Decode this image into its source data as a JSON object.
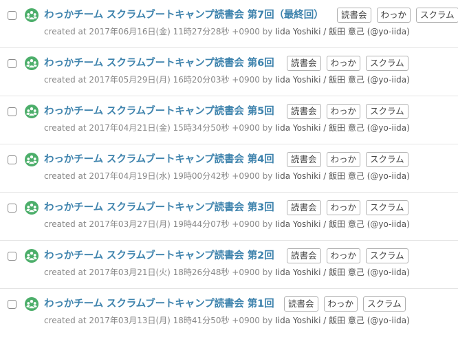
{
  "posts": [
    {
      "title": "わっかチーム スクラムブートキャンプ読書会 第7回（最終回）",
      "meta_prefix": "created at 2017年06月16日(金) 11時27分28秒 +0900 by",
      "author": "Iida Yoshiki / 飯田 意己 (@yo-iida)",
      "tags": [
        "読書会",
        "わっか",
        "スクラム"
      ]
    },
    {
      "title": "わっかチーム スクラムブートキャンプ読書会 第6回",
      "meta_prefix": "created at 2017年05月29日(月) 16時20分03秒 +0900 by",
      "author": "Iida Yoshiki / 飯田 意己 (@yo-iida)",
      "tags": [
        "読書会",
        "わっか",
        "スクラム"
      ]
    },
    {
      "title": "わっかチーム スクラムブートキャンプ読書会 第5回",
      "meta_prefix": "created at 2017年04月21日(金) 15時34分50秒 +0900 by",
      "author": "Iida Yoshiki / 飯田 意己 (@yo-iida)",
      "tags": [
        "読書会",
        "わっか",
        "スクラム"
      ]
    },
    {
      "title": "わっかチーム スクラムブートキャンプ読書会 第4回",
      "meta_prefix": "created at 2017年04月19日(水) 19時00分42秒 +0900 by",
      "author": "Iida Yoshiki / 飯田 意己 (@yo-iida)",
      "tags": [
        "読書会",
        "わっか",
        "スクラム"
      ]
    },
    {
      "title": "わっかチーム スクラムブートキャンプ読書会 第3回",
      "meta_prefix": "created at 2017年03月27日(月) 19時44分07秒 +0900 by",
      "author": "Iida Yoshiki / 飯田 意己 (@yo-iida)",
      "tags": [
        "読書会",
        "わっか",
        "スクラム"
      ]
    },
    {
      "title": "わっかチーム スクラムブートキャンプ読書会 第2回",
      "meta_prefix": "created at 2017年03月21日(火) 18時26分48秒 +0900 by",
      "author": "Iida Yoshiki / 飯田 意己 (@yo-iida)",
      "tags": [
        "読書会",
        "わっか",
        "スクラム"
      ]
    },
    {
      "title": "わっかチーム スクラムブートキャンプ読書会 第1回",
      "meta_prefix": "created at 2017年03月13日(月) 18時41分50秒 +0900 by",
      "author": "Iida Yoshiki / 飯田 意己 (@yo-iida)",
      "tags": [
        "読書会",
        "わっか",
        "スクラム"
      ]
    }
  ],
  "icon": "team-group-icon",
  "colors": {
    "title": "#3e83ad",
    "meta": "#888888",
    "icon": "#4cae6a"
  }
}
